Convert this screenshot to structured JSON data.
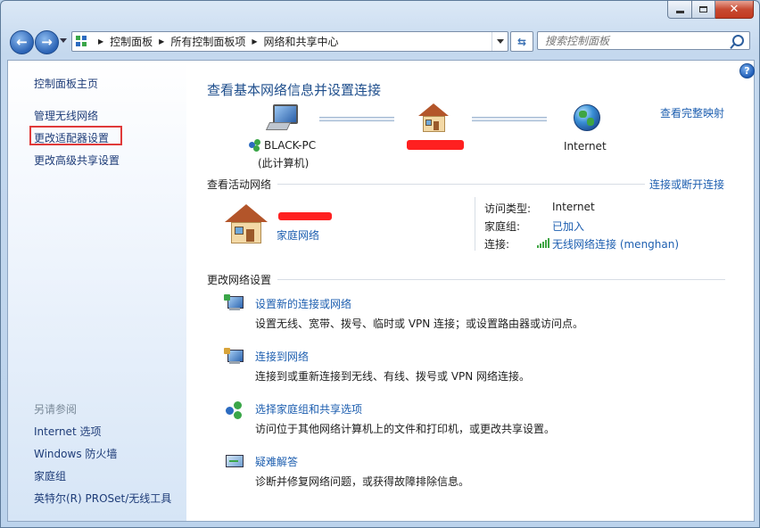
{
  "window": {
    "controls": {
      "minimize": "minimize",
      "maximize": "maximize",
      "close": "✕"
    }
  },
  "nav": {
    "back": "←",
    "forward": "→",
    "breadcrumb": [
      "控制面板",
      "所有控制面板项",
      "网络和共享中心"
    ],
    "search_placeholder": "搜索控制面板"
  },
  "sidebar": {
    "home": "控制面板主页",
    "tasks": [
      "管理无线网络",
      "更改适配器设置",
      "更改高级共享设置"
    ],
    "see_also_title": "另请参阅",
    "see_also": [
      "Internet 选项",
      "Windows 防火墙",
      "家庭组",
      "英特尔(R) PROSet/无线工具"
    ]
  },
  "main": {
    "title": "查看基本网络信息并设置连接",
    "view_full_map": "查看完整映射",
    "map": {
      "pc_name": "BLACK-PC",
      "pc_sub": "(此计算机)",
      "internet": "Internet"
    },
    "active_section": "查看活动网络",
    "connect_disconnect": "连接或断开连接",
    "network_type": "家庭网络",
    "access_type_label": "访问类型:",
    "access_type_value": "Internet",
    "homegroup_label": "家庭组:",
    "homegroup_value": "已加入",
    "connection_label": "连接:",
    "connection_value": "无线网络连接 (menghan)",
    "change_section": "更改网络设置",
    "tasks": [
      {
        "title": "设置新的连接或网络",
        "desc": "设置无线、宽带、拨号、临时或 VPN 连接；或设置路由器或访问点。"
      },
      {
        "title": "连接到网络",
        "desc": "连接到或重新连接到无线、有线、拨号或 VPN 网络连接。"
      },
      {
        "title": "选择家庭组和共享选项",
        "desc": "访问位于其他网络计算机上的文件和打印机，或更改共享设置。"
      },
      {
        "title": "疑难解答",
        "desc": "诊断并修复网络问题，或获得故障排除信息。"
      }
    ]
  },
  "colors": {
    "link": "#1e5fb0",
    "title": "#1e4e8c",
    "highlight": "#e03a3a"
  }
}
